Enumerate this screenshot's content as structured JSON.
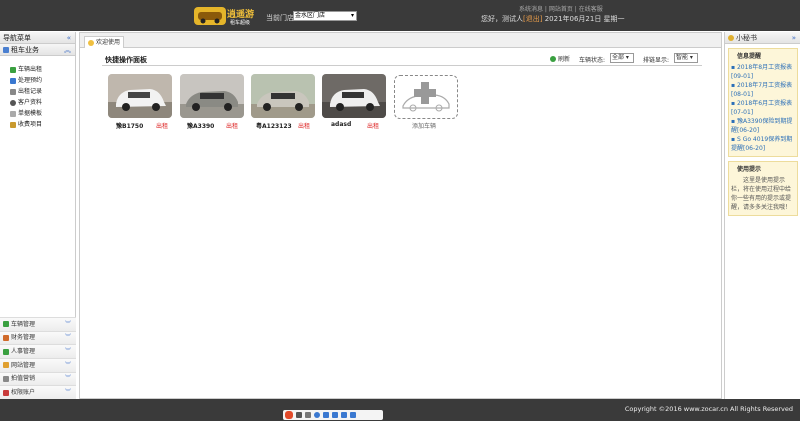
{
  "header": {
    "logo_text": "逍遥游",
    "logo_subtext": "租车超级",
    "store_label": "当前门店:",
    "store_value": "金水区门店",
    "top_links": [
      "系统消息",
      "网站首页",
      "在线客服"
    ],
    "greeting": "您好，测试人",
    "logout": "[退出]",
    "date": "2021年06月21日 星期一"
  },
  "left_nav": {
    "title": "导航菜单",
    "section_title": "租车业务",
    "items": [
      "车辆出租",
      "处理预约",
      "出租记录",
      "客户资料",
      "单据模板",
      "收费项目"
    ],
    "bottom_sections": [
      "车辆管理",
      "财务管理",
      "人事管理",
      "网站管理",
      "拍值营销",
      "权限账户"
    ]
  },
  "tab": {
    "label": "欢迎使用"
  },
  "panel": {
    "title": "快捷操作面板",
    "refresh_label": "刷新",
    "status_label": "车辆状态:",
    "status_value": "全部",
    "order_label": "排链显示:",
    "order_value": "智能"
  },
  "cars": [
    {
      "plate": "豫B1750",
      "status": "出租"
    },
    {
      "plate": "豫A3390",
      "status": "出租"
    },
    {
      "plate": "粤A123123",
      "status": "出租"
    },
    {
      "plate": "adasd",
      "status": "出租"
    }
  ],
  "add_car_label": "添加车辆",
  "right_panel": {
    "title": "小秘书",
    "info_title": "信息提醒",
    "messages": [
      "2018年8月工资报表[09-01]",
      "2018年7月工资报表[08-01]",
      "2018年6月工资报表[07-01]",
      "豫A3390保险到期提醒[06-20]",
      "S Go 4019保养到期提醒[06-20]"
    ],
    "tips_title": "使用提示",
    "tips_text": "这里是使用提示栏，将在使用过程中给你一些有用的提示或提醒，请多多关注我哦！"
  },
  "footer": {
    "copyright": "Copyright ©2016 www.zocar.cn All Rights Reserved"
  },
  "colors": {
    "header_bg": "#3a3a3a",
    "rent_red": "#dd2222",
    "link_blue": "#2b6fb8",
    "notice_bg": "#fdf6d9"
  }
}
